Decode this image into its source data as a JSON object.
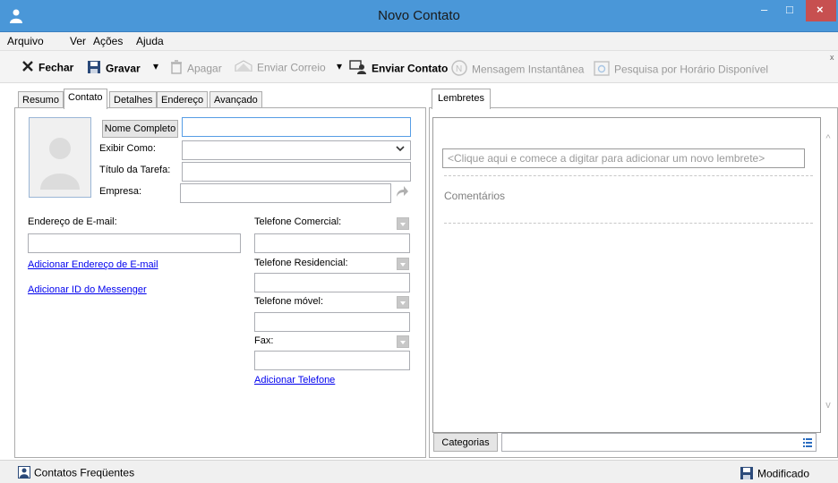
{
  "window": {
    "title": "Novo Contato",
    "minimize_glyph": "–",
    "maximize_glyph": "□",
    "close_glyph": "×"
  },
  "menu": [
    "Arquivo",
    "Ver",
    "Ações",
    "Ajuda"
  ],
  "toolbar": {
    "close_label": "Fechar",
    "save_label": "Gravar",
    "delete_label": "Apagar",
    "send_mail_label": "Enviar Correio",
    "send_contact_label": "Enviar Contato",
    "im_label": "Mensagem Instantânea",
    "availability_label": "Pesquisa por Horário Disponível",
    "dropdown_glyph": "▾",
    "collapse_glyph": "x"
  },
  "tabs": [
    "Resumo",
    "Contato",
    "Detalhes",
    "Endereço",
    "Avançado"
  ],
  "active_tab": "Contato",
  "contact": {
    "full_name_button": "Nome Completo",
    "full_name_value": "",
    "display_as_label": "Exibir Como:",
    "display_as_value": "",
    "job_title_label": "Título da Tarefa:",
    "job_title_value": "",
    "company_label": "Empresa:",
    "company_value": "",
    "email_label": "Endereço de E-mail:",
    "email_value": "",
    "add_email_link": "Adicionar Endereço de E-mail",
    "add_messenger_link": "Adicionar ID do Messenger",
    "business_phone_label": "Telefone Comercial:",
    "home_phone_label": "Telefone Residencial:",
    "mobile_phone_label": "Telefone móvel:",
    "fax_label": "Fax:",
    "add_phone_link": "Adicionar Telefone"
  },
  "right_panel": {
    "tab": "Lembretes",
    "reminder_placeholder": "<Clique aqui e comece a digitar para adicionar um novo lembrete>",
    "comments_label": "Comentários",
    "categories_button": "Categorias",
    "categories_value": "",
    "scroll_up_glyph": "^",
    "scroll_down_glyph": "v"
  },
  "statusbar": {
    "left": "Contatos Freqüentes",
    "right": "Modificado"
  },
  "colors": {
    "titlebar": "#4a97d8",
    "close_button": "#c75050",
    "link": "#0000ee",
    "focus_border": "#569de5"
  },
  "icons": {
    "app": "contact-person-icon",
    "close": "x-icon",
    "save": "floppy-disk-icon",
    "delete": "trash-icon",
    "mail": "envelope-icon",
    "send_contact": "contact-card-icon",
    "im": "messenger-icon",
    "availability": "calendar-search-icon",
    "share": "share-arrow-icon",
    "categories": "list-icon",
    "status_contacts": "contact-book-icon",
    "status_modified": "floppy-disk-icon"
  }
}
